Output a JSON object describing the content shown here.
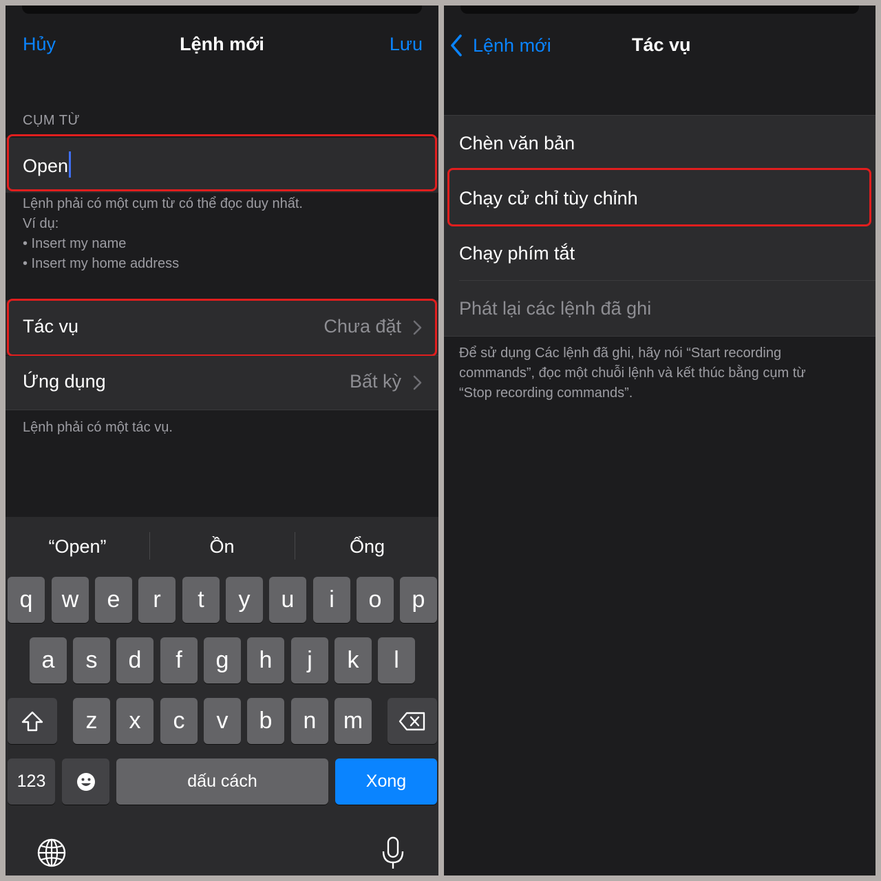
{
  "left": {
    "nav": {
      "cancel": "Hủy",
      "title": "Lệnh mới",
      "save": "Lưu"
    },
    "phrase_header": "CỤM TỪ",
    "phrase_value": "Open",
    "phrase_hint": {
      "line1": "Lệnh phải có một cụm từ có thể đọc duy nhất.",
      "line2": "Ví dụ:",
      "line3": "• Insert my name",
      "line4": "• Insert my home address"
    },
    "rows": [
      {
        "label": "Tác vụ",
        "value": "Chưa đặt"
      },
      {
        "label": "Ứng dụng",
        "value": "Bất kỳ"
      }
    ],
    "action_hint": "Lệnh phải có một tác vụ.",
    "keyboard": {
      "suggestions": [
        "“Open”",
        "Ồn",
        "Ổng"
      ],
      "row1": [
        "q",
        "w",
        "e",
        "r",
        "t",
        "y",
        "u",
        "i",
        "o",
        "p"
      ],
      "row2": [
        "a",
        "s",
        "d",
        "f",
        "g",
        "h",
        "j",
        "k",
        "l"
      ],
      "row3": [
        "z",
        "x",
        "c",
        "v",
        "b",
        "n",
        "m"
      ],
      "numbers_key": "123",
      "space_key": "dấu cách",
      "done_key": "Xong"
    }
  },
  "right": {
    "nav": {
      "back": "Lệnh mới",
      "title": "Tác vụ"
    },
    "items": [
      "Chèn văn bản",
      "Chạy cử chỉ tùy chỉnh",
      "Chạy phím tắt",
      "Phát lại các lệnh đã ghi"
    ],
    "footnote": {
      "line1": "Để sử dụng Các lệnh đã ghi, hãy nói “Start recording",
      "line2": "commands”, đọc một chuỗi lệnh và kết thúc bằng cụm từ",
      "line3": "“Stop recording commands”."
    }
  },
  "colors": {
    "accent": "#0a84ff",
    "highlight": "#e01e1e",
    "background": "#1c1c1e",
    "cell": "#2c2c2e"
  },
  "icons": [
    "chevron-left-icon",
    "chevron-right-icon",
    "shift-icon",
    "backspace-icon",
    "emoji-icon",
    "globe-icon",
    "microphone-icon"
  ]
}
